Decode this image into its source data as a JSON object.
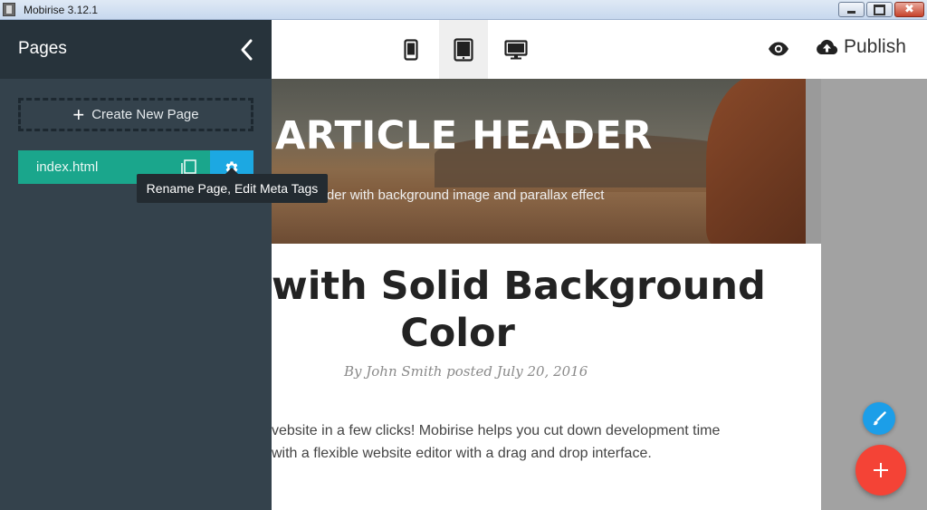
{
  "window": {
    "title": "Mobirise 3.12.1",
    "close_glyph": "✖"
  },
  "sidebar": {
    "title": "Pages",
    "create_page_label": "Create New Page",
    "create_page_plus": "+",
    "pages": [
      {
        "name": "index.html"
      }
    ],
    "tooltip": "Rename Page, Edit Meta Tags"
  },
  "toolbar": {
    "devices": [
      "mobile",
      "tablet",
      "desktop"
    ],
    "active_device": "tablet",
    "publish_label": "Publish"
  },
  "preview": {
    "hero_title": "ARTICLE HEADER",
    "hero_subtitle": "rticle header with background image and parallax effect",
    "article_title_line1": "with Solid Background",
    "article_title_line2": "Color",
    "byline": "By John Smith posted July 20, 2016",
    "body_line1": "vebsite in a few clicks! Mobirise helps you cut down development time",
    "body_line2": "with a flexible website editor with a drag and drop interface."
  },
  "fab": {
    "add_glyph": "+"
  },
  "colors": {
    "sidebar_bg": "#34424c",
    "sidebar_header_bg": "#27333b",
    "page_item_bg": "#1aa68c",
    "settings_btn_bg": "#1ca8e2",
    "fab_add_bg": "#f44336",
    "fab_edit_bg": "#1c9ee8"
  }
}
